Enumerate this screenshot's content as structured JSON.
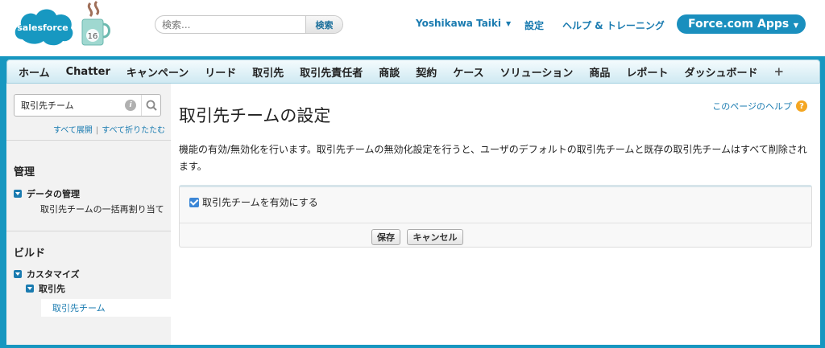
{
  "header": {
    "logo_text": "salesforce",
    "mug_badge": "16",
    "search_placeholder": "検索...",
    "search_button": "検索",
    "user_name": "Yoshikawa Taiki",
    "setup_link": "設定",
    "help_link": "ヘルプ & トレーニング",
    "app_menu": "Force.com Apps"
  },
  "tabs": [
    "ホーム",
    "Chatter",
    "キャンペーン",
    "リード",
    "取引先",
    "取引先責任者",
    "商談",
    "契約",
    "ケース",
    "ソリューション",
    "商品",
    "レポート",
    "ダッシュボード"
  ],
  "tab_plus": "+",
  "sidebar": {
    "search_value": "取引先チーム",
    "expand_all": "すべて展開",
    "separator": "|",
    "collapse_all": "すべて折りたたむ",
    "section_admin": "管理",
    "data_management": "データの管理",
    "mass_reassign": "取引先チームの一括再割り当て",
    "section_build": "ビルド",
    "customize": "カスタマイズ",
    "accounts": "取引先",
    "account_teams": "取引先チーム"
  },
  "main": {
    "title": "取引先チームの設定",
    "help_for_page": "このページのヘルプ",
    "description": "機能の有効/無効化を行います。取引先チームの無効化設定を行うと、ユーザのデフォルトの取引先チームと既存の取引先チームはすべて削除されます。",
    "enable_checkbox_label": "取引先チームを有効にする",
    "save_button": "保存",
    "cancel_button": "キャンセル"
  },
  "colors": {
    "brand_blue": "#1797c0",
    "link_blue": "#1a7bb0",
    "help_orange": "#f4a622",
    "checkbox_blue": "#3b86d6"
  }
}
